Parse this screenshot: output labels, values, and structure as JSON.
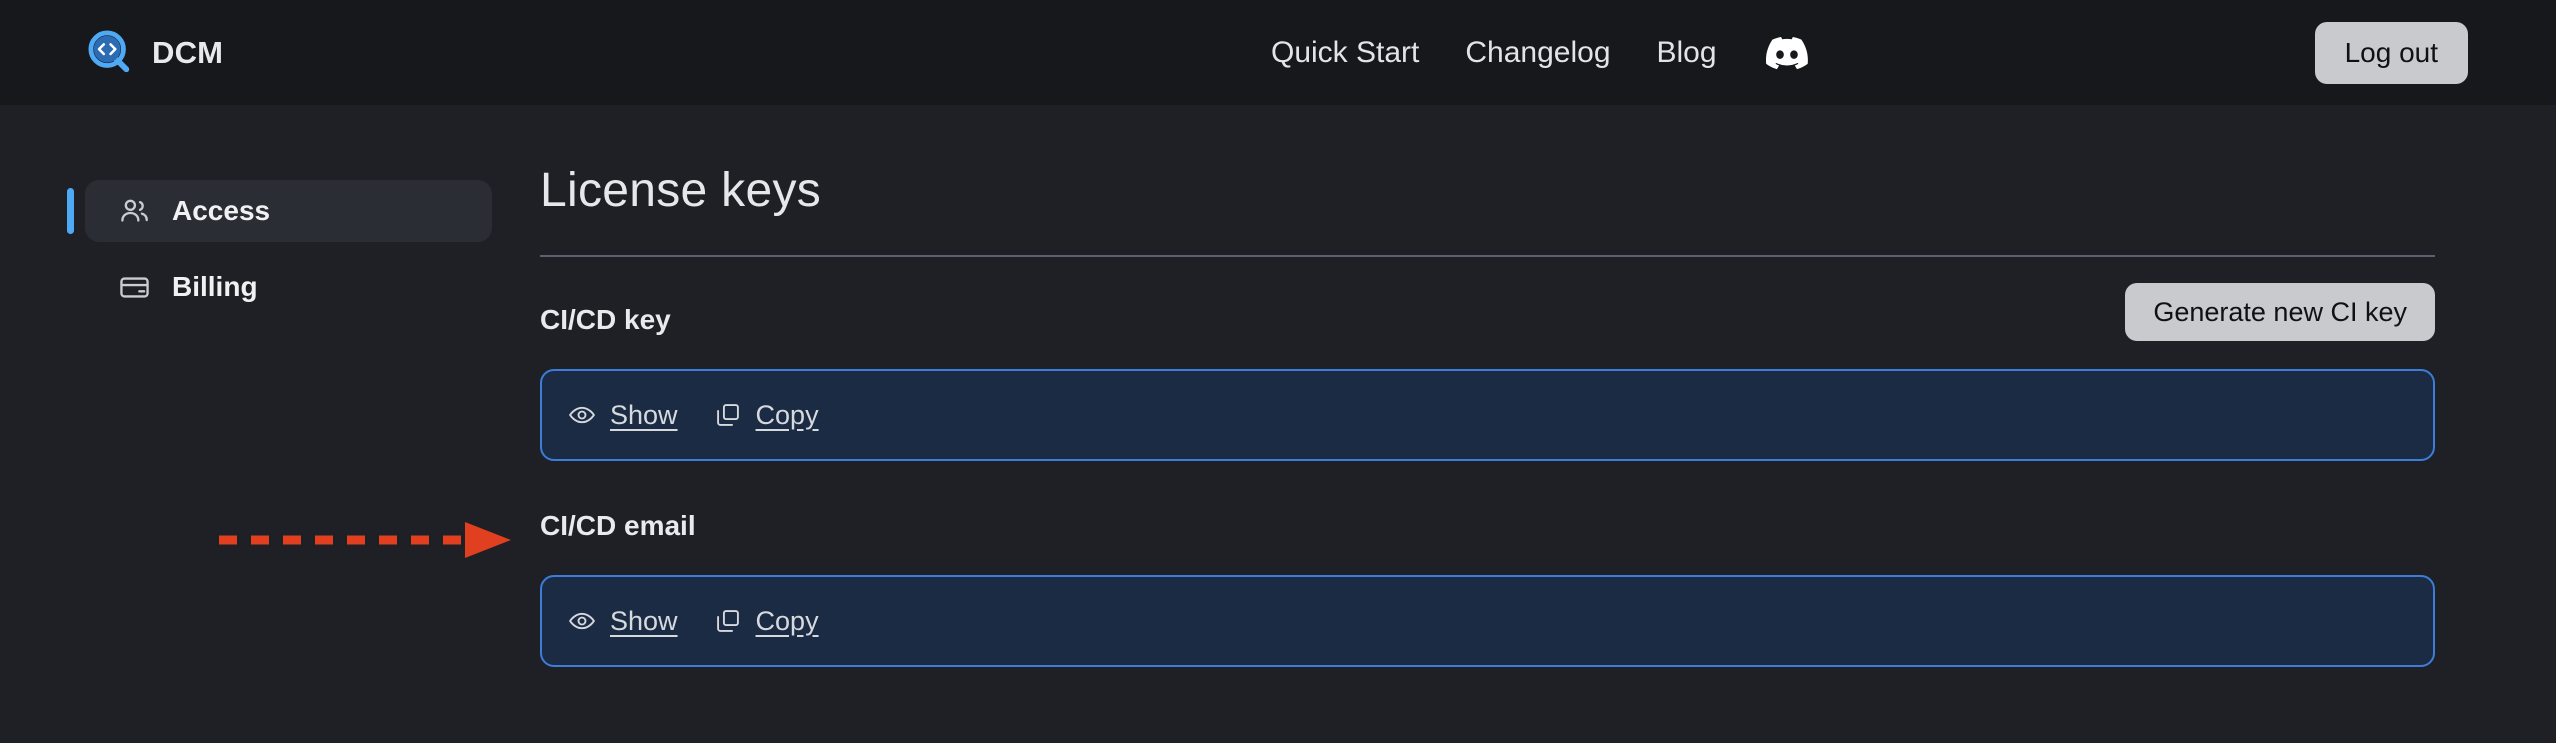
{
  "header": {
    "brand": "DCM",
    "logo_icon": "code-magnifier-logo",
    "nav": [
      {
        "label": "Quick Start",
        "name": "nav-quick-start"
      },
      {
        "label": "Changelog",
        "name": "nav-changelog"
      },
      {
        "label": "Blog",
        "name": "nav-blog"
      }
    ],
    "discord_icon": "discord-icon",
    "logout_label": "Log out"
  },
  "sidebar": {
    "items": [
      {
        "label": "Access",
        "icon": "users-icon",
        "active": true
      },
      {
        "label": "Billing",
        "icon": "credit-card-icon",
        "active": false
      }
    ]
  },
  "main": {
    "title": "License keys",
    "sections": [
      {
        "label": "CI/CD key",
        "button_label": "Generate new CI key",
        "show_label": "Show",
        "copy_label": "Copy",
        "show_icon": "eye-icon",
        "copy_icon": "copy-icon"
      },
      {
        "label": "CI/CD email",
        "show_label": "Show",
        "copy_label": "Copy",
        "show_icon": "eye-icon",
        "copy_icon": "copy-icon"
      }
    ]
  },
  "annotation": {
    "arrow_color": "#e0401f",
    "arrow_style": "dashed-right-arrow"
  },
  "colors": {
    "header_bg": "#16181c",
    "body_bg": "#1e2025",
    "accent_blue": "#4eaaf5",
    "card_bg": "#1c2b44",
    "card_border": "#3b7dd8",
    "button_bg": "#c9cacd",
    "divider": "#5a6270"
  }
}
